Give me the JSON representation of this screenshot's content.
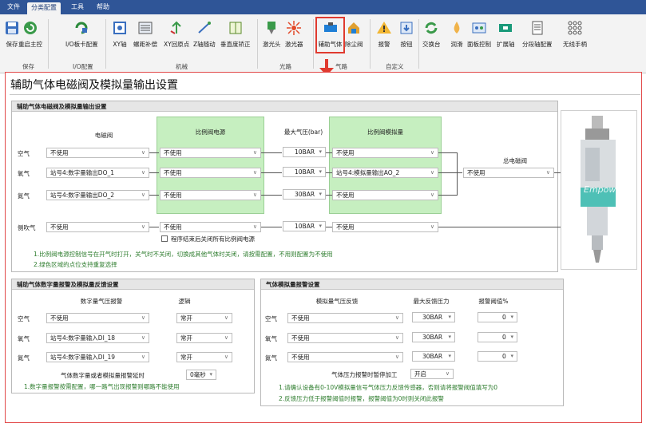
{
  "menubar": {
    "items": [
      "文件",
      "分类配置",
      "工具",
      "帮助"
    ],
    "active": "分类配置"
  },
  "ribbon": {
    "buttons": [
      "保存",
      "重启主控",
      "I/O板卡配置",
      "XY轴",
      "螺距补偿",
      "XY回原点",
      "Z轴随动",
      "垂直度矫正",
      "激光头",
      "激光器",
      "辅助气体",
      "除尘阀",
      "报警",
      "按钮",
      "交换台",
      "润滑",
      "面板控制",
      "扩展轴",
      "分段轴配置",
      "无线手柄"
    ],
    "groups": [
      "保存",
      "I/O配置",
      "机械",
      "光路",
      "气路",
      "自定义"
    ]
  },
  "page": {
    "title": "辅助气体电磁阀及模拟量输出设置"
  },
  "sec1": {
    "title": "辅助气体电磁阀及模拟量输出设置",
    "col_solenoid": "电磁阀",
    "col_prop_power": "比例阀电源",
    "col_max_pressure": "最大气压(bar)",
    "col_prop_analog": "比例阀模拟量",
    "col_main_valve": "总电磁阀",
    "rows": [
      {
        "label": "空气",
        "solenoid": "不使用",
        "power": "不使用",
        "pressure": "10BAR",
        "analog": "不使用"
      },
      {
        "label": "氧气",
        "solenoid": "站号4:数字量输出DO_1",
        "power": "不使用",
        "pressure": "10BAR",
        "analog": "站号4:模拟量输出AO_2"
      },
      {
        "label": "氮气",
        "solenoid": "站号4:数字量输出DO_2",
        "power": "不使用",
        "pressure": "30BAR",
        "analog": "不使用"
      }
    ],
    "main_valve_value": "不使用",
    "side_blow": {
      "label": "侧吹气",
      "solenoid": "不使用",
      "power": "不使用",
      "pressure": "10BAR",
      "analog": "不使用"
    },
    "checkbox_label": "程序结束后关闭所有比例阀电源",
    "notes": [
      "1.比例阀电源控制信号在开气时打开，关气时不关闭，切换成其他气体时关闭，请按需配置，不用则配置为不使用",
      "2.绿色区域的点位支持重复选择"
    ]
  },
  "sec2": {
    "title": "辅助气体数字量报警及模拟量反馈设置",
    "col_alarm": "数字量气压报警",
    "col_logic": "逻辑",
    "rows": [
      {
        "label": "空气",
        "alarm": "不使用",
        "logic": "常开"
      },
      {
        "label": "氧气",
        "alarm": "站号4:数字量输入DI_18",
        "logic": "常开"
      },
      {
        "label": "氮气",
        "alarm": "站号4:数字量输入DI_19",
        "logic": "常开"
      }
    ],
    "delay_label": "气体数字量或者模拟量报警延时",
    "delay_value": "0毫秒",
    "note": "1.数字量报警按需配置，哪一路气出现报警则哪路不能使用"
  },
  "sec3": {
    "title": "气体模拟量报警设置",
    "col_feedback": "模拟量气压反馈",
    "col_max": "最大反馈压力",
    "col_threshold": "报警阈值%",
    "rows": [
      {
        "label": "空气",
        "feedback": "不使用",
        "max": "30BAR",
        "threshold": "0"
      },
      {
        "label": "氧气",
        "feedback": "不使用",
        "max": "30BAR",
        "threshold": "0"
      },
      {
        "label": "氮气",
        "feedback": "不使用",
        "max": "30BAR",
        "threshold": "0"
      }
    ],
    "pause_label": "气体压力报警时暂停加工",
    "pause_value": "开启",
    "notes": [
      "1.请确认设备有0-10V模拟量信号气体压力反馈传感器，否则请将报警阈值填写为0",
      "2.反馈压力低于报警阈值时报警，报警阈值为0时则关闭此报警"
    ]
  },
  "image": {
    "watermark": "Empower"
  }
}
